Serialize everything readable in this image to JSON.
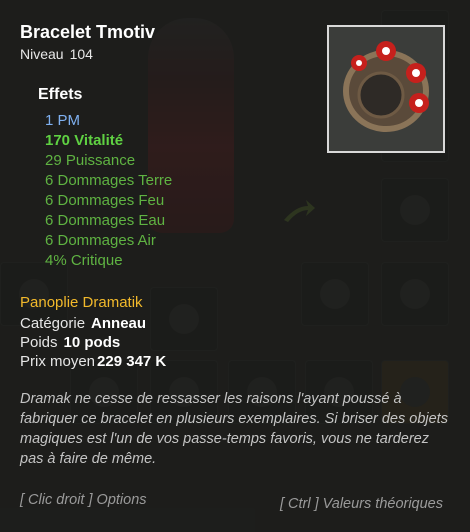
{
  "item": {
    "name": "Bracelet Tmotiv",
    "level_label": "Niveau",
    "level": "104"
  },
  "effects": {
    "heading": "Effets",
    "list": [
      "1 PM",
      "170 Vitalité",
      "29 Puissance",
      "6 Dommages Terre",
      "6 Dommages Feu",
      "6 Dommages Eau",
      "6 Dommages Air",
      "4% Critique"
    ]
  },
  "info": {
    "set_name": "Panoplie Dramatik",
    "category_label": "Catégorie",
    "category": "Anneau",
    "weight_label": "Poids",
    "weight": "10 pods",
    "price_label": "Prix moyen",
    "price": "229 347 K"
  },
  "description": "Dramak ne cesse de ressasser les raisons l'ayant poussé à fabriquer ce bracelet en plusieurs exemplaires. Si briser des objets magiques est l'un de vos passe-temps favoris, vous ne tarderez pas à faire de même.",
  "hints": {
    "options": "[ Clic droit ] Options",
    "theoretical": "[ Ctrl ] Valeurs théoriques"
  },
  "colors": {
    "effect_pm": "#7fb0f0",
    "effect_green": "#5fb342",
    "set_name": "#f2b92b"
  }
}
